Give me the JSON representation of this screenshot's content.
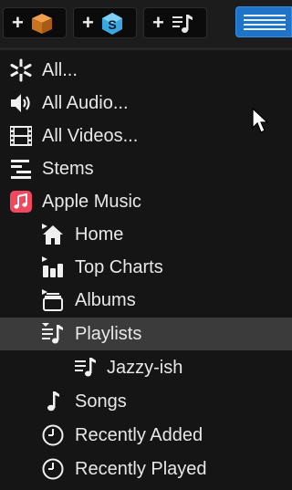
{
  "toolbar": {
    "buttons": [
      {
        "label": "+",
        "icon": "package-box-icon"
      },
      {
        "label": "+",
        "icon": "stems-s-icon"
      },
      {
        "label": "+",
        "icon": "playlist-music-icon"
      }
    ],
    "view_toggle_icon": "list-view-icon",
    "accent": "#1e74c8"
  },
  "tree": {
    "items": [
      {
        "label": "All...",
        "icon": "all-asterisk-icon",
        "level": 0
      },
      {
        "label": "All Audio...",
        "icon": "speaker-icon",
        "level": 0
      },
      {
        "label": "All Videos...",
        "icon": "film-icon",
        "level": 0
      },
      {
        "label": "Stems",
        "icon": "stems-icon",
        "level": 0
      },
      {
        "label": "Apple Music",
        "icon": "apple-music-icon",
        "level": 0,
        "icon_color": "#f0485f"
      },
      {
        "label": "Home",
        "icon": "home-icon",
        "level": 1
      },
      {
        "label": "Top Charts",
        "icon": "bar-chart-icon",
        "level": 1
      },
      {
        "label": "Albums",
        "icon": "albums-icon",
        "level": 1
      },
      {
        "label": "Playlists",
        "icon": "playlists-icon",
        "level": 1,
        "selected": true
      },
      {
        "label": "Jazzy-ish",
        "icon": "playlist-icon",
        "level": 2
      },
      {
        "label": "Songs",
        "icon": "music-note-icon",
        "level": 1
      },
      {
        "label": "Recently Added",
        "icon": "clock-icon",
        "level": 1
      },
      {
        "label": "Recently Played",
        "icon": "clock-icon",
        "level": 1
      }
    ]
  },
  "colors": {
    "background": "#151515",
    "selected_row": "#3b3b3b",
    "text": "#e8e8e8"
  }
}
